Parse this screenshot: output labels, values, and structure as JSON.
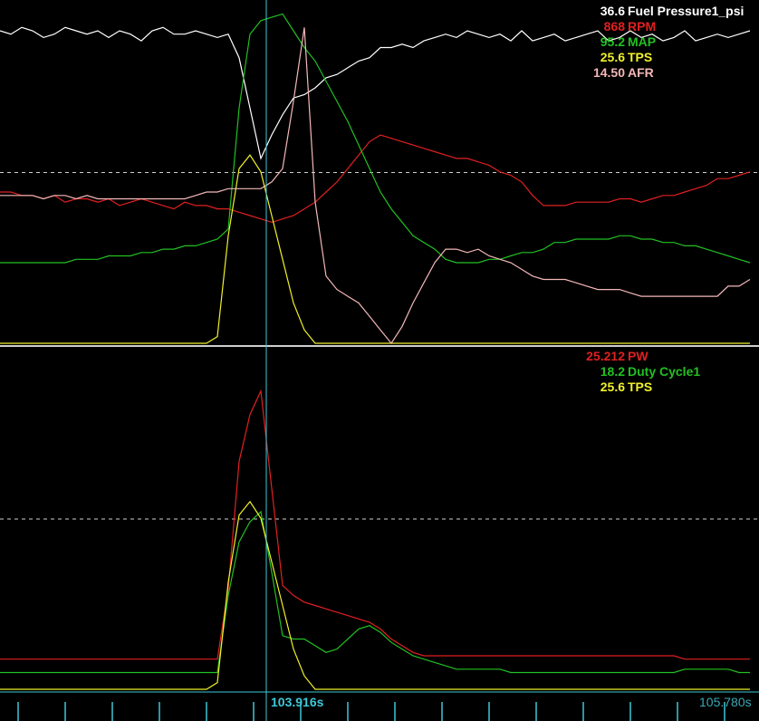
{
  "colors": {
    "background": "#000000",
    "cursor": "#3ec8d8",
    "separator": "#cfcfcf",
    "fuel_pressure": "#ffffff",
    "rpm": "#e02020",
    "map": "#22c022",
    "tps": "#f0f02a",
    "afr": "#f4b8b8",
    "pw": "#e02020",
    "duty_cycle": "#22c022"
  },
  "time_axis": {
    "cursor_label": "103.916s",
    "end_label": "105.780s"
  },
  "top_panel": {
    "legend": [
      {
        "value": "36.6",
        "name": "Fuel Pressure1_psi",
        "color_key": "fuel_pressure"
      },
      {
        "value": "868",
        "name": "RPM",
        "color_key": "rpm"
      },
      {
        "value": "95.2",
        "name": "MAP",
        "color_key": "map"
      },
      {
        "value": "25.6",
        "name": "TPS",
        "color_key": "tps"
      },
      {
        "value": "14.50",
        "name": "AFR",
        "color_key": "afr"
      }
    ]
  },
  "bottom_panel": {
    "legend": [
      {
        "value": "25.212",
        "name": "PW",
        "color_key": "pw"
      },
      {
        "value": "18.2",
        "name": "Duty Cycle1",
        "color_key": "duty_cycle"
      },
      {
        "value": "25.6",
        "name": "TPS",
        "color_key": "tps"
      }
    ]
  },
  "chart_data": [
    {
      "type": "line",
      "title": "",
      "y_scale": "normalized 0-1 per trace",
      "grid": "dashed midline",
      "x": [
        0,
        12,
        24,
        36,
        48,
        60,
        72,
        84,
        96,
        108,
        120,
        132,
        144,
        156,
        168,
        180,
        192,
        204,
        216,
        228,
        240,
        252,
        264,
        276,
        288,
        300,
        312,
        324,
        336,
        348,
        360,
        372,
        384,
        396,
        408,
        420,
        432,
        444,
        456,
        468,
        480,
        492,
        504,
        516,
        528,
        540,
        552,
        564,
        576,
        588,
        600,
        612,
        624,
        636,
        648,
        660,
        672,
        684,
        696,
        708,
        720,
        732,
        744,
        756,
        768,
        780,
        792,
        804,
        816,
        828
      ],
      "series": [
        {
          "name": "Fuel Pressure1_psi",
          "color_key": "fuel_pressure",
          "values": [
            0.93,
            0.92,
            0.94,
            0.93,
            0.91,
            0.92,
            0.94,
            0.93,
            0.92,
            0.93,
            0.91,
            0.93,
            0.92,
            0.9,
            0.93,
            0.94,
            0.92,
            0.92,
            0.93,
            0.92,
            0.91,
            0.92,
            0.85,
            0.7,
            0.55,
            0.62,
            0.68,
            0.73,
            0.74,
            0.76,
            0.79,
            0.8,
            0.82,
            0.84,
            0.85,
            0.88,
            0.88,
            0.89,
            0.88,
            0.9,
            0.91,
            0.92,
            0.91,
            0.93,
            0.92,
            0.91,
            0.92,
            0.9,
            0.93,
            0.9,
            0.91,
            0.92,
            0.9,
            0.91,
            0.92,
            0.93,
            0.9,
            0.91,
            0.93,
            0.91,
            0.92,
            0.9,
            0.91,
            0.93,
            0.9,
            0.91,
            0.92,
            0.91,
            0.92,
            0.93
          ]
        },
        {
          "name": "RPM",
          "color_key": "rpm",
          "values": [
            0.45,
            0.45,
            0.44,
            0.44,
            0.43,
            0.44,
            0.42,
            0.43,
            0.43,
            0.42,
            0.43,
            0.41,
            0.42,
            0.43,
            0.42,
            0.41,
            0.4,
            0.42,
            0.41,
            0.41,
            0.4,
            0.4,
            0.39,
            0.38,
            0.37,
            0.36,
            0.37,
            0.38,
            0.4,
            0.42,
            0.45,
            0.48,
            0.52,
            0.56,
            0.6,
            0.62,
            0.61,
            0.6,
            0.59,
            0.58,
            0.57,
            0.56,
            0.55,
            0.55,
            0.54,
            0.53,
            0.51,
            0.5,
            0.48,
            0.44,
            0.41,
            0.41,
            0.41,
            0.42,
            0.42,
            0.42,
            0.42,
            0.43,
            0.43,
            0.42,
            0.43,
            0.44,
            0.44,
            0.45,
            0.46,
            0.47,
            0.49,
            0.49,
            0.5,
            0.51
          ]
        },
        {
          "name": "MAP",
          "color_key": "map",
          "values": [
            0.24,
            0.24,
            0.24,
            0.24,
            0.24,
            0.24,
            0.24,
            0.25,
            0.25,
            0.25,
            0.26,
            0.26,
            0.26,
            0.27,
            0.27,
            0.28,
            0.28,
            0.29,
            0.29,
            0.3,
            0.31,
            0.34,
            0.7,
            0.92,
            0.96,
            0.97,
            0.98,
            0.93,
            0.88,
            0.84,
            0.78,
            0.72,
            0.66,
            0.59,
            0.52,
            0.45,
            0.4,
            0.36,
            0.32,
            0.3,
            0.28,
            0.25,
            0.24,
            0.24,
            0.24,
            0.25,
            0.25,
            0.26,
            0.27,
            0.27,
            0.28,
            0.3,
            0.3,
            0.31,
            0.31,
            0.31,
            0.31,
            0.32,
            0.32,
            0.31,
            0.31,
            0.3,
            0.3,
            0.29,
            0.29,
            0.28,
            0.27,
            0.26,
            0.25,
            0.24
          ]
        },
        {
          "name": "TPS",
          "color_key": "tps",
          "values": [
            0,
            0,
            0,
            0,
            0,
            0,
            0,
            0,
            0,
            0,
            0,
            0,
            0,
            0,
            0,
            0,
            0,
            0,
            0,
            0,
            0.02,
            0.32,
            0.52,
            0.56,
            0.51,
            0.38,
            0.25,
            0.12,
            0.04,
            0,
            0,
            0,
            0,
            0,
            0,
            0,
            0,
            0,
            0,
            0,
            0,
            0,
            0,
            0,
            0,
            0,
            0,
            0,
            0,
            0,
            0,
            0,
            0,
            0,
            0,
            0,
            0,
            0,
            0,
            0,
            0,
            0,
            0,
            0,
            0,
            0,
            0,
            0,
            0,
            0
          ]
        },
        {
          "name": "AFR",
          "color_key": "afr",
          "values": [
            0.44,
            0.44,
            0.44,
            0.44,
            0.43,
            0.44,
            0.44,
            0.43,
            0.44,
            0.43,
            0.43,
            0.43,
            0.43,
            0.43,
            0.43,
            0.43,
            0.43,
            0.43,
            0.44,
            0.45,
            0.45,
            0.46,
            0.46,
            0.46,
            0.46,
            0.48,
            0.52,
            0.72,
            0.94,
            0.42,
            0.2,
            0.16,
            0.14,
            0.12,
            0.08,
            0.04,
            0,
            0.05,
            0.12,
            0.18,
            0.24,
            0.28,
            0.28,
            0.27,
            0.28,
            0.26,
            0.25,
            0.24,
            0.22,
            0.2,
            0.19,
            0.19,
            0.19,
            0.18,
            0.17,
            0.16,
            0.16,
            0.16,
            0.15,
            0.14,
            0.14,
            0.14,
            0.14,
            0.14,
            0.14,
            0.14,
            0.14,
            0.17,
            0.17,
            0.19
          ]
        }
      ]
    },
    {
      "type": "line",
      "title": "",
      "y_scale": "normalized 0-1 per trace",
      "grid": "dashed midline",
      "x": [
        0,
        12,
        24,
        36,
        48,
        60,
        72,
        84,
        96,
        108,
        120,
        132,
        144,
        156,
        168,
        180,
        192,
        204,
        216,
        228,
        240,
        252,
        264,
        276,
        288,
        300,
        312,
        324,
        336,
        348,
        360,
        372,
        384,
        396,
        408,
        420,
        432,
        444,
        456,
        468,
        480,
        492,
        504,
        516,
        528,
        540,
        552,
        564,
        576,
        588,
        600,
        612,
        624,
        636,
        648,
        660,
        672,
        684,
        696,
        708,
        720,
        732,
        744,
        756,
        768,
        780,
        792,
        804,
        816,
        828
      ],
      "series": [
        {
          "name": "PW",
          "color_key": "pw",
          "values": [
            0.09,
            0.09,
            0.09,
            0.09,
            0.09,
            0.09,
            0.09,
            0.09,
            0.09,
            0.09,
            0.09,
            0.09,
            0.09,
            0.09,
            0.09,
            0.09,
            0.09,
            0.09,
            0.09,
            0.09,
            0.09,
            0.3,
            0.68,
            0.82,
            0.89,
            0.6,
            0.31,
            0.28,
            0.26,
            0.25,
            0.24,
            0.23,
            0.22,
            0.21,
            0.2,
            0.18,
            0.15,
            0.13,
            0.11,
            0.1,
            0.1,
            0.1,
            0.1,
            0.1,
            0.1,
            0.1,
            0.1,
            0.1,
            0.1,
            0.1,
            0.1,
            0.1,
            0.1,
            0.1,
            0.1,
            0.1,
            0.1,
            0.1,
            0.1,
            0.1,
            0.1,
            0.1,
            0.1,
            0.09,
            0.09,
            0.09,
            0.09,
            0.09,
            0.09,
            0.09
          ]
        },
        {
          "name": "Duty Cycle1",
          "color_key": "duty_cycle",
          "values": [
            0.05,
            0.05,
            0.05,
            0.05,
            0.05,
            0.05,
            0.05,
            0.05,
            0.05,
            0.05,
            0.05,
            0.05,
            0.05,
            0.05,
            0.05,
            0.05,
            0.05,
            0.05,
            0.05,
            0.05,
            0.05,
            0.28,
            0.44,
            0.5,
            0.53,
            0.35,
            0.16,
            0.15,
            0.15,
            0.13,
            0.11,
            0.12,
            0.15,
            0.18,
            0.19,
            0.17,
            0.14,
            0.12,
            0.1,
            0.09,
            0.08,
            0.07,
            0.06,
            0.06,
            0.06,
            0.06,
            0.06,
            0.05,
            0.05,
            0.05,
            0.05,
            0.05,
            0.05,
            0.05,
            0.05,
            0.05,
            0.05,
            0.05,
            0.05,
            0.05,
            0.05,
            0.05,
            0.05,
            0.06,
            0.06,
            0.06,
            0.06,
            0.06,
            0.05,
            0.05
          ]
        },
        {
          "name": "TPS",
          "color_key": "tps",
          "values": [
            0,
            0,
            0,
            0,
            0,
            0,
            0,
            0,
            0,
            0,
            0,
            0,
            0,
            0,
            0,
            0,
            0,
            0,
            0,
            0,
            0.02,
            0.32,
            0.52,
            0.56,
            0.51,
            0.38,
            0.25,
            0.12,
            0.04,
            0,
            0,
            0,
            0,
            0,
            0,
            0,
            0,
            0,
            0,
            0,
            0,
            0,
            0,
            0,
            0,
            0,
            0,
            0,
            0,
            0,
            0,
            0,
            0,
            0,
            0,
            0,
            0,
            0,
            0,
            0,
            0,
            0,
            0,
            0,
            0,
            0,
            0,
            0,
            0,
            0
          ]
        }
      ]
    }
  ]
}
